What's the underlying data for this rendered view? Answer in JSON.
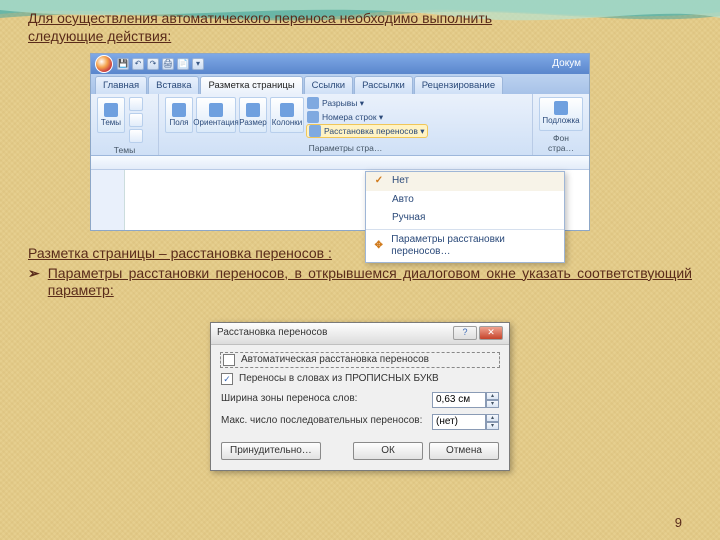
{
  "intro_line1": "Для осуществления автоматического переноса необходимо выполнить",
  "intro_line2": "следующие действия:",
  "word": {
    "doc_title": "Докум",
    "qat": [
      "💾",
      "↶",
      "↷",
      "🖨",
      "📄",
      "▾"
    ],
    "tabs": [
      "Главная",
      "Вставка",
      "Разметка страницы",
      "Ссылки",
      "Рассылки",
      "Рецензирование"
    ],
    "active_tab": 2,
    "group_themes": {
      "btn": "Темы",
      "sub": [
        "Aa",
        "◉",
        "🗀"
      ],
      "label": "Темы"
    },
    "group_setup": {
      "btns": [
        "Поля",
        "Ориентация",
        "Размер",
        "Колонки"
      ],
      "stack": [
        "Разрывы ▾",
        "Номера строк ▾",
        "Расстановка переносов ▾"
      ],
      "hl_index": 2,
      "label": "Параметры стра…"
    },
    "group_bg": {
      "btn": "Подложка",
      "label": "Фон стра…"
    },
    "dropdown": {
      "items": [
        "Нет",
        "Авто",
        "Ручная"
      ],
      "checked_index": 0,
      "params": "Параметры расстановки переносов…"
    }
  },
  "mid_line1": "Разметка страницы – расстановка переносов :",
  "mid_bullet": "Параметры расстановки переносов, в открывшемся диалоговом окне указать соответствующий параметр:",
  "dialog": {
    "title": "Расстановка переносов",
    "chk1": "Автоматическая расстановка переносов",
    "chk2": "Переносы в словах из ПРОПИСНЫХ БУКВ",
    "chk2_checked": true,
    "field1_label": "Ширина зоны переноса слов:",
    "field1_value": "0,63 см",
    "field2_label": "Макс. число последовательных переносов:",
    "field2_value": "(нет)",
    "btn_force": "Принудительно…",
    "btn_ok": "ОК",
    "btn_cancel": "Отмена"
  },
  "page_number": "9"
}
